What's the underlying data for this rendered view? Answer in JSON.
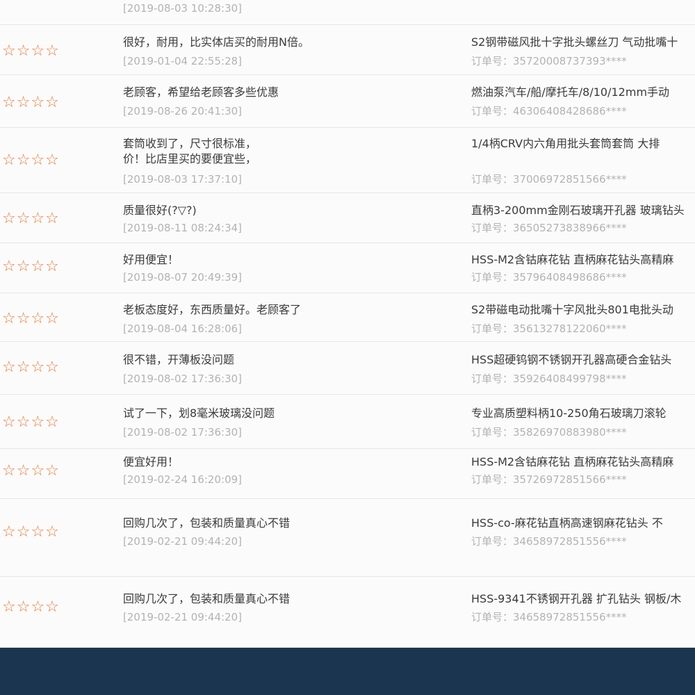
{
  "star_glyph": "☆☆☆☆",
  "colors": {
    "star": "#e07a3f",
    "background_outer": "#1b3550",
    "panel": "#fbfbfb",
    "muted_text": "#b3b3b3",
    "text": "#3a3a3a"
  },
  "reviews": [
    {
      "stars": "",
      "comment": [
        ""
      ],
      "date": "[2019-08-03 10:28:30]",
      "product": "",
      "order": ""
    },
    {
      "stars": "☆☆☆☆",
      "comment": [
        "很好，耐用，比实体店买的耐用N倍。"
      ],
      "date": "[2019-01-04 22:55:28]",
      "product": "S2钢带磁风批十字批头螺丝刀 气动批嘴十",
      "order": "订单号：35720008737393****"
    },
    {
      "stars": "☆☆☆☆",
      "comment": [
        "老顾客，希望给老顾客多些优惠"
      ],
      "date": "[2019-08-26 20:41:30]",
      "product": "燃油泵汽车/船/摩托车/8/10/12mm手动",
      "order": "订单号：46306408428686****"
    },
    {
      "stars": "☆☆☆☆",
      "comment": [
        "套筒收到了，尺寸很标准，",
        "价！比店里买的要便宜些，"
      ],
      "date": "[2019-08-03 17:37:10]",
      "product": "1/4柄CRV内六角用批头套筒套筒 大排",
      "order": "订单号：37006972851566****"
    },
    {
      "stars": "☆☆☆☆",
      "comment": [
        "质量很好(?▽?)"
      ],
      "date": "[2019-08-11 08:24:34]",
      "product": "直柄3-200mm金刚石玻璃开孔器 玻璃钻头",
      "order": "订单号：36505273838966****"
    },
    {
      "stars": "☆☆☆☆",
      "comment": [
        "好用便宜！"
      ],
      "date": "[2019-08-07 20:49:39]",
      "product": "HSS-M2含钴麻花钻 直柄麻花钻头高精麻",
      "order": "订单号：35796408498686****"
    },
    {
      "stars": "☆☆☆☆",
      "comment": [
        "老板态度好，东西质量好。老顾客了"
      ],
      "date": "[2019-08-04 16:28:06]",
      "product": "S2带磁电动批嘴十字风批头801电批头动",
      "order": "订单号：35613278122060****"
    },
    {
      "stars": "☆☆☆☆",
      "comment": [
        "很不错，开薄板没问题"
      ],
      "date": "[2019-08-02 17:36:30]",
      "product": "HSS超硬钨钢不锈钢开孔器高硬合金钻头",
      "order": "订单号：35926408499798****"
    },
    {
      "stars": "☆☆☆☆",
      "comment": [
        "试了一下，划8毫米玻璃没问题"
      ],
      "date": "[2019-08-02 17:36:30]",
      "product": "专业高质塑料柄10-250角石玻璃刀滚轮",
      "order": "订单号：35826970883980****"
    },
    {
      "stars": "☆☆☆☆",
      "comment": [
        "便宜好用！"
      ],
      "date": "[2019-02-24 16:20:09]",
      "product": "HSS-M2含钴麻花钻 直柄麻花钻头高精麻",
      "order": "订单号：35726972851566****"
    },
    {
      "stars": "☆☆☆☆",
      "comment": [
        "回购几次了，包装和质量真心不错"
      ],
      "date": "[2019-02-21 09:44:20]",
      "product": "HSS-co-麻花钻直柄高速钢麻花钻头 不",
      "order": "订单号：34658972851556****"
    },
    {
      "stars": "☆☆☆☆",
      "comment": [
        "回购几次了，包装和质量真心不错"
      ],
      "date": "[2019-02-21 09:44:20]",
      "product": "HSS-9341不锈钢开孔器 扩孔钻头 钢板/木",
      "order": "订单号：34658972851556****"
    }
  ]
}
